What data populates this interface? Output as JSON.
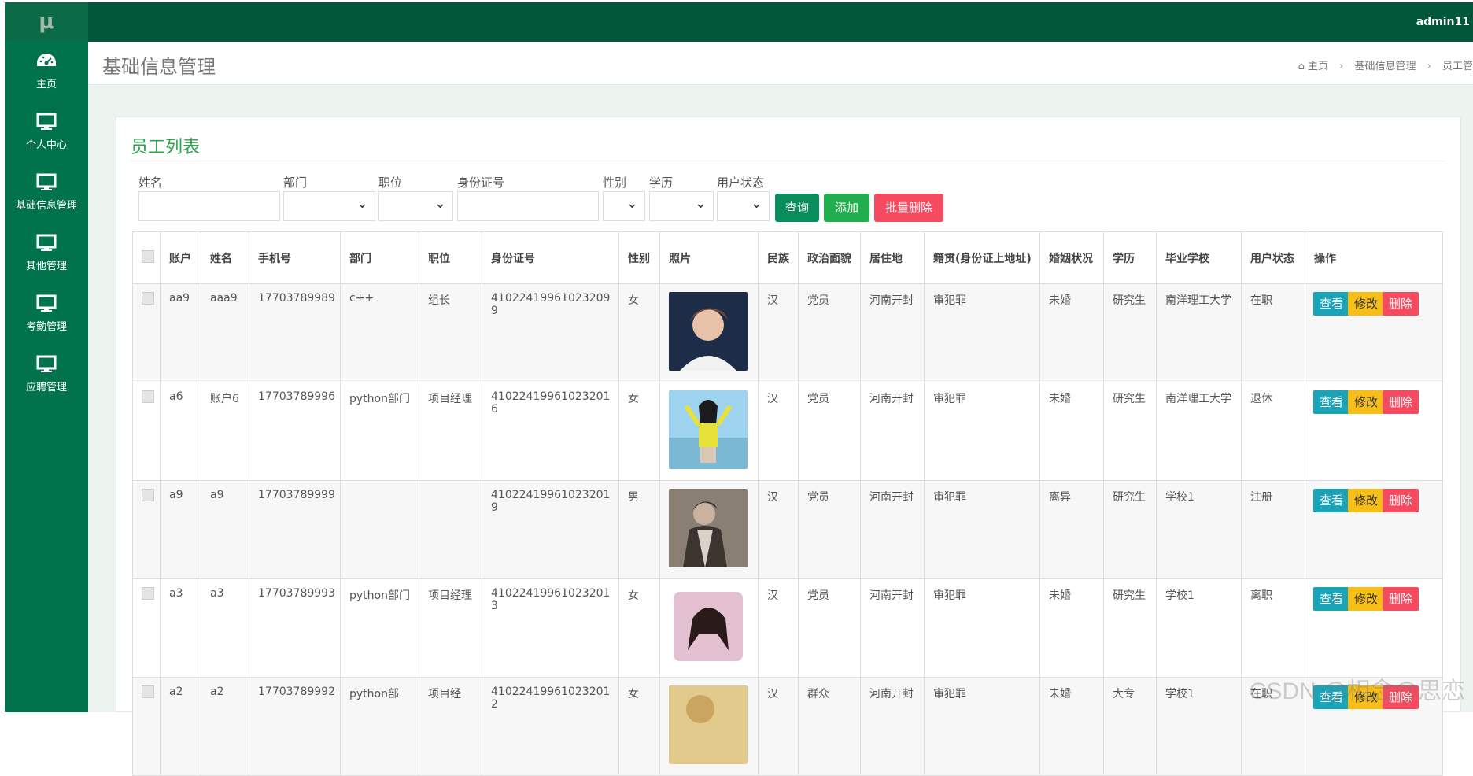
{
  "topbar": {
    "logo": "μ",
    "user": "admin11"
  },
  "sidebar": {
    "items": [
      {
        "label": "主页",
        "icon": "dashboard-icon"
      },
      {
        "label": "个人中心",
        "icon": "monitor-icon"
      },
      {
        "label": "基础信息管理",
        "icon": "monitor-icon"
      },
      {
        "label": "其他管理",
        "icon": "monitor-icon"
      },
      {
        "label": "考勤管理",
        "icon": "monitor-icon"
      },
      {
        "label": "应聘管理",
        "icon": "monitor-icon"
      }
    ]
  },
  "header": {
    "title": "基础信息管理",
    "breadcrumb": {
      "home": "主页",
      "level1": "基础信息管理",
      "level2": "员工管"
    }
  },
  "panel": {
    "title": "员工列表"
  },
  "filters": {
    "name_label": "姓名",
    "dept_label": "部门",
    "position_label": "职位",
    "idcard_label": "身份证号",
    "gender_label": "性别",
    "education_label": "学历",
    "status_label": "用户状态"
  },
  "buttons": {
    "query": "查询",
    "add": "添加",
    "batch_delete": "批量删除"
  },
  "table": {
    "headers": {
      "account": "账户",
      "name": "姓名",
      "phone": "手机号",
      "dept": "部门",
      "position": "职位",
      "idcard": "身份证号",
      "gender": "性别",
      "photo": "照片",
      "ethnic": "民族",
      "political": "政治面貌",
      "residence": "居住地",
      "native": "籍贯(身份证上地址)",
      "marital": "婚姻状况",
      "education": "学历",
      "school": "毕业学校",
      "status": "用户状态",
      "actions": "操作"
    },
    "rows": [
      {
        "account": "aa9",
        "name": "aaa9",
        "phone": "17703789989",
        "dept": "c++",
        "position": "组长",
        "idcard": "410224199610232099",
        "gender": "女",
        "ethnic": "汉",
        "political": "党员",
        "residence": "河南开封",
        "native": "审犯罪",
        "marital": "未婚",
        "education": "研究生",
        "school": "南洋理工大学",
        "status": "在职"
      },
      {
        "account": "a6",
        "name": "账户6",
        "phone": "17703789996",
        "dept": "python部门",
        "position": "项目经理",
        "idcard": "410224199610232016",
        "gender": "女",
        "ethnic": "汉",
        "political": "党员",
        "residence": "河南开封",
        "native": "审犯罪",
        "marital": "未婚",
        "education": "研究生",
        "school": "南洋理工大学",
        "status": "退休"
      },
      {
        "account": "a9",
        "name": "a9",
        "phone": "17703789999",
        "dept": "",
        "position": "",
        "idcard": "410224199610232019",
        "gender": "男",
        "ethnic": "汉",
        "political": "党员",
        "residence": "河南开封",
        "native": "审犯罪",
        "marital": "离异",
        "education": "研究生",
        "school": "学校1",
        "status": "注册"
      },
      {
        "account": "a3",
        "name": "a3",
        "phone": "17703789993",
        "dept": "python部门",
        "position": "项目经理",
        "idcard": "410224199610232013",
        "gender": "女",
        "ethnic": "汉",
        "political": "党员",
        "residence": "河南开封",
        "native": "审犯罪",
        "marital": "未婚",
        "education": "研究生",
        "school": "学校1",
        "status": "离职"
      },
      {
        "account": "a2",
        "name": "a2",
        "phone": "17703789992",
        "dept": "python部",
        "position": "项目经",
        "idcard": "410224199610232012",
        "gender": "女",
        "ethnic": "汉",
        "political": "群众",
        "residence": "河南开封",
        "native": "审犯罪",
        "marital": "未婚",
        "education": "大专",
        "school": "学校1",
        "status": "在职"
      }
    ],
    "op_labels": {
      "view": "查看",
      "edit": "修改",
      "delete": "删除"
    }
  },
  "watermark": "CSDN @相念@思恋"
}
